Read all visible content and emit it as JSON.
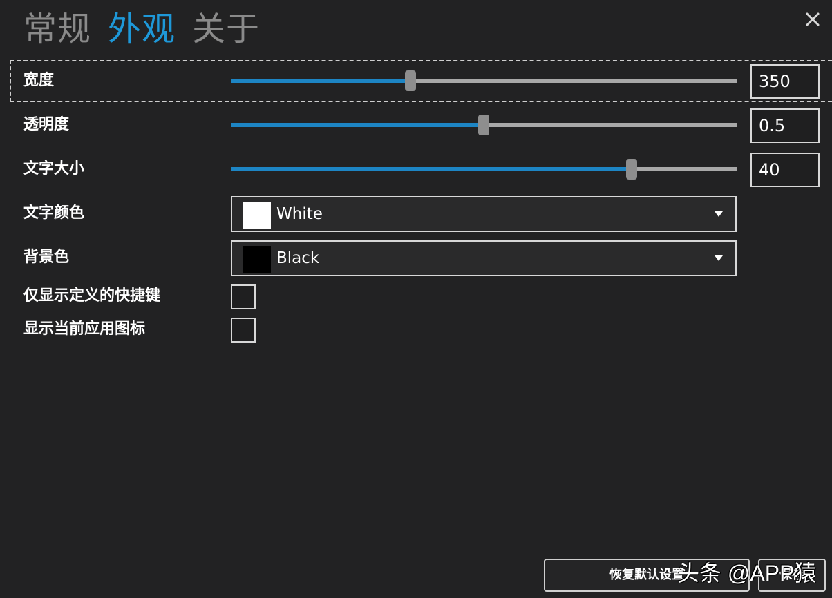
{
  "header": {
    "tabs": [
      {
        "label": "常规",
        "active": false
      },
      {
        "label": "外观",
        "active": true
      },
      {
        "label": "关于",
        "active": false
      }
    ],
    "close_icon": "close-icon"
  },
  "settings": {
    "width": {
      "label": "宽度",
      "value": "350",
      "fraction": 0.355
    },
    "opacity": {
      "label": "透明度",
      "value": "0.5",
      "fraction": 0.5
    },
    "font_size": {
      "label": "文字大小",
      "value": "40",
      "fraction": 0.792
    },
    "text_color": {
      "label": "文字颜色",
      "selected": "White",
      "swatch": "#ffffff"
    },
    "background_color": {
      "label": "背景色",
      "selected": "Black",
      "swatch": "#000000"
    },
    "only_defined_shortcuts": {
      "label": "仅显示定义的快捷键",
      "checked": false
    },
    "show_current_app_icon": {
      "label": "显示当前应用图标",
      "checked": false
    }
  },
  "footer": {
    "reset_label": "恢复默认设置",
    "save_label": "保存"
  },
  "watermark": "头条 @APP猿",
  "colors": {
    "accent": "#1e98d8",
    "slider_fill": "#1d85c4",
    "background": "#222223"
  }
}
